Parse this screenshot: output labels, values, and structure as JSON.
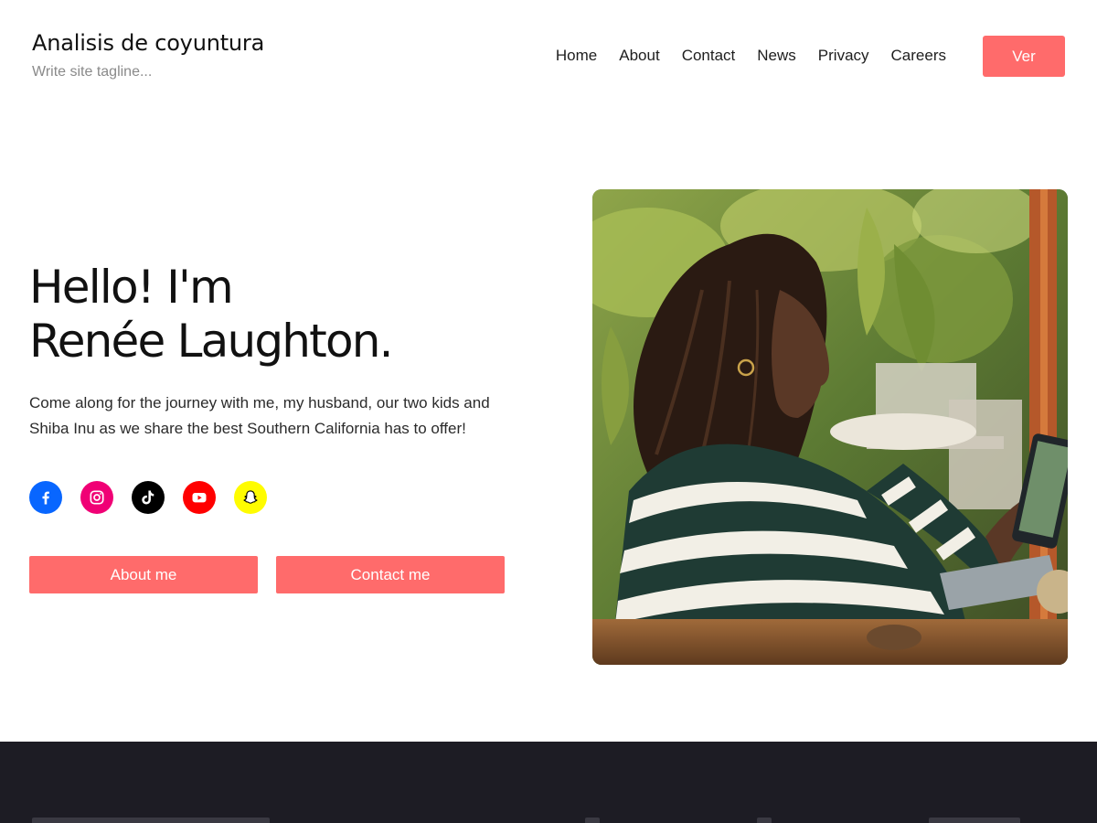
{
  "header": {
    "site_title": "Analisis de coyuntura",
    "tagline": "Write site tagline...",
    "nav": [
      "Home",
      "About",
      "Contact",
      "News",
      "Privacy",
      "Careers"
    ],
    "cta_label": "Ver"
  },
  "hero": {
    "title_line1": "Hello! I'm",
    "title_line2": "Renée Laughton.",
    "description": "Come along for the journey with me, my husband, our two kids and Shiba Inu as we share the best Southern California has to offer!",
    "socials": [
      {
        "name": "Facebook",
        "icon": "facebook-icon",
        "color": "#0866ff"
      },
      {
        "name": "Instagram",
        "icon": "instagram-icon",
        "color": "#f00075"
      },
      {
        "name": "TikTok",
        "icon": "tiktok-icon",
        "color": "#000000"
      },
      {
        "name": "YouTube",
        "icon": "youtube-icon",
        "color": "#ff0000"
      },
      {
        "name": "Snapchat",
        "icon": "snapchat-icon",
        "color": "#fffc00"
      }
    ],
    "about_button": "About me",
    "contact_button": "Contact me"
  },
  "colors": {
    "accent": "#ff6b6b",
    "footer_bg": "#1d1c24"
  }
}
